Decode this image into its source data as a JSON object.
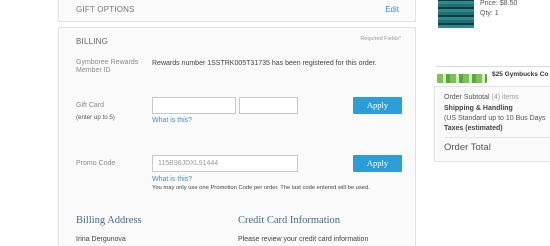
{
  "gift_options": {
    "title": "GIFT OPTIONS",
    "edit": "Edit"
  },
  "billing": {
    "title": "BILLING",
    "required": "Required Fields*",
    "rewards": {
      "label_line1": "Gymboree Rewards",
      "label_line2": "Member ID",
      "message": "Rewards number 1SSTRK005T31735 has been registered for this order."
    },
    "gift_card": {
      "label": "Gift Card",
      "note": "(enter up to 5)",
      "number_value": "",
      "pin_value": "",
      "apply": "Apply",
      "what": "What is this?"
    },
    "promo": {
      "label": "Promo Code",
      "value": "115B98JDXL91444",
      "apply": "Apply",
      "what": "What is this?",
      "fine_print": "You may only use one Promotion Code per order. The last code entered will be used."
    },
    "billing_address": {
      "heading": "Billing Address",
      "name": "Irina Dergunova"
    },
    "credit_card": {
      "heading": "Credit Card Information",
      "text": "Please review your credit card information"
    }
  },
  "cart_item": {
    "price": "Price: $8.50",
    "qty": "Qty: 1"
  },
  "promo_banner": {
    "text": "$25 Gymbucks Co"
  },
  "summary": {
    "subtotal_label": "Order Subtotal",
    "subtotal_count": "(4) items",
    "shipping": "Shipping & Handling",
    "shipping_detail": "(US Standard up to 10 Bus Days",
    "taxes": "Taxes (estimated)",
    "total": "Order Total"
  }
}
